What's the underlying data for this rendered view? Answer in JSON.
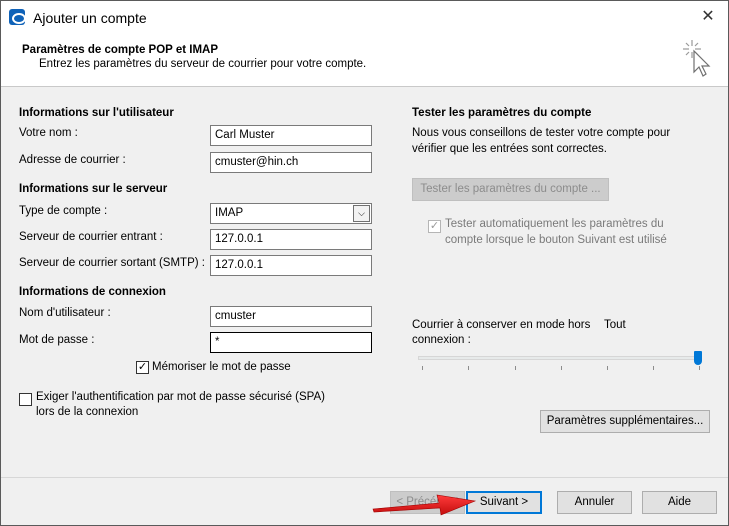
{
  "window": {
    "title": "Ajouter un compte",
    "close_glyph": "✕"
  },
  "header": {
    "title": "Paramètres de compte POP et IMAP",
    "subtitle": "Entrez les paramètres du serveur de courrier pour votre compte."
  },
  "user_info": {
    "section": "Informations sur l'utilisateur",
    "name_label": "Votre nom :",
    "name_value": "Carl Muster",
    "email_label": "Adresse de courrier :",
    "email_value": "cmuster@hin.ch"
  },
  "server_info": {
    "section": "Informations sur le serveur",
    "account_type_label": "Type de compte :",
    "account_type_value": "IMAP",
    "incoming_label": "Serveur de courrier entrant :",
    "incoming_value": "127.0.0.1",
    "outgoing_label": "Serveur de courrier sortant (SMTP) :",
    "outgoing_value": "127.0.0.1"
  },
  "login_info": {
    "section": "Informations de connexion",
    "username_label": "Nom d'utilisateur :",
    "username_value": "cmuster",
    "password_label": "Mot de passe :",
    "password_value": "*",
    "remember_label": "Mémoriser le mot de passe",
    "remember_checked": true
  },
  "spa": {
    "label_line1": "Exiger l'authentification par mot de passe sécurisé (SPA)",
    "label_line2": "lors de la connexion",
    "checked": false
  },
  "test": {
    "section": "Tester les paramètres du compte",
    "desc_line1": "Nous vous conseillons de tester votre compte pour",
    "desc_line2": "vérifier que les entrées sont correctes.",
    "button_label": "Tester les paramètres du compte ...",
    "auto_line1": "Tester automatiquement les paramètres du",
    "auto_line2": "compte lorsque le bouton Suivant est utilisé",
    "auto_checked": true
  },
  "offline": {
    "label_line1": "Courrier à conserver en mode hors",
    "label_line2": "connexion :",
    "value_text": "Tout",
    "slider_fraction": 1.0
  },
  "more_settings_label": "Paramètres supplémentaires...",
  "footer": {
    "back_label": "< Précédent",
    "next_label": "Suivant >",
    "cancel_label": "Annuler",
    "help_label": "Aide"
  },
  "icons": {
    "app": "outlook-icon",
    "wizard": "cursor-sparkle-icon",
    "check": "✓",
    "dropdown": "chevron-down-icon",
    "arrow_color": "#e81818"
  }
}
